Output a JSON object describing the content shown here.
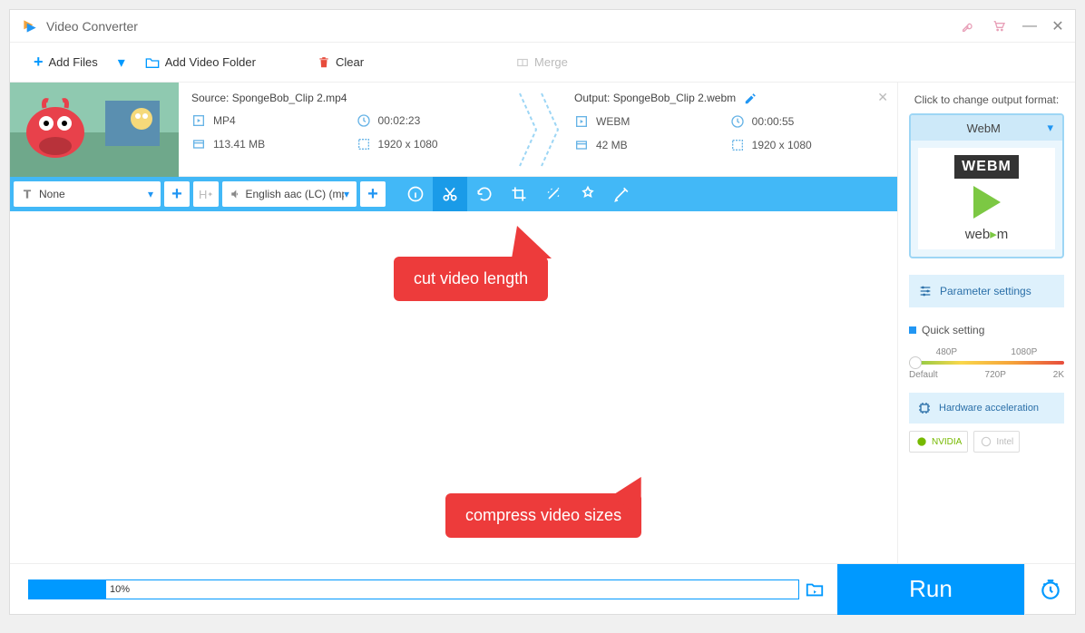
{
  "app": {
    "title": "Video Converter"
  },
  "toolbar": {
    "add_files": "Add Files",
    "add_folder": "Add Video Folder",
    "clear": "Clear",
    "merge": "Merge"
  },
  "file": {
    "source_label": "Source: SpongeBob_Clip 2.mp4",
    "output_label": "Output: SpongeBob_Clip 2.webm",
    "source": {
      "format": "MP4",
      "duration": "00:02:23",
      "size": "113.41 MB",
      "resolution": "1920 x 1080"
    },
    "output": {
      "format": "WEBM",
      "duration": "00:00:55",
      "size": "42 MB",
      "resolution": "1920 x 1080"
    }
  },
  "bluebar": {
    "subtitle": "None",
    "audio": "English aac (LC) (mp"
  },
  "callouts": {
    "cut": "cut video length",
    "compress": "compress video sizes"
  },
  "sidebar": {
    "change_format": "Click to change output format:",
    "format_name": "WebM",
    "format_badge": "WEBM",
    "format_text_a": "web",
    "format_text_b": "m",
    "parameter_settings": "Parameter settings",
    "quick_setting": "Quick setting",
    "slider_top": {
      "a": "480P",
      "b": "1080P"
    },
    "slider_bottom": {
      "a": "Default",
      "b": "720P",
      "c": "2K"
    },
    "hardware": "Hardware acceleration",
    "nvidia": "NVIDIA",
    "intel": "Intel"
  },
  "bottom": {
    "progress_text": "10%",
    "progress_percent": 10,
    "run": "Run"
  }
}
